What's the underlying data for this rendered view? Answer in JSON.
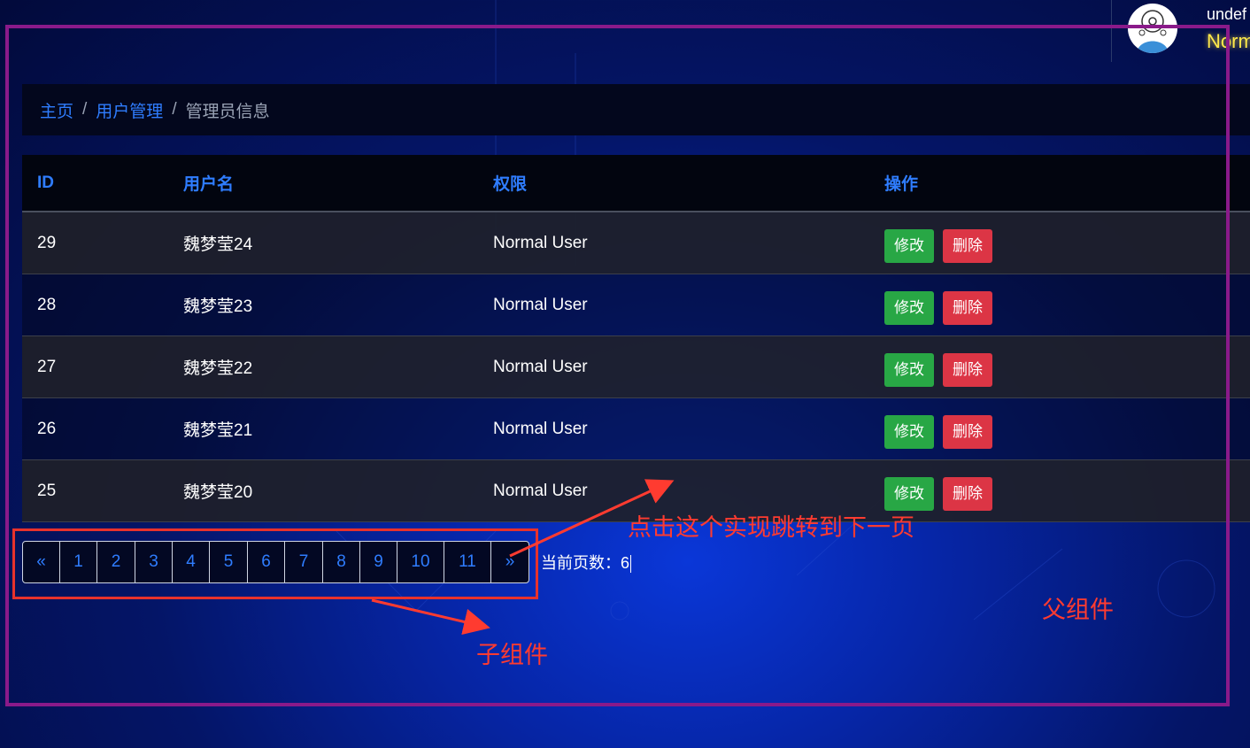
{
  "user": {
    "name": "undef",
    "role": "Norm"
  },
  "breadcrumb": {
    "home": "主页",
    "section": "用户管理",
    "current": "管理员信息",
    "separator": "/"
  },
  "table": {
    "headers": [
      "ID",
      "用户名",
      "权限",
      "操作"
    ],
    "rows": [
      {
        "id": "29",
        "name": "魏梦莹24",
        "permission": "Normal User",
        "edit": "修改",
        "delete": "删除"
      },
      {
        "id": "28",
        "name": "魏梦莹23",
        "permission": "Normal User",
        "edit": "修改",
        "delete": "删除"
      },
      {
        "id": "27",
        "name": "魏梦莹22",
        "permission": "Normal User",
        "edit": "修改",
        "delete": "删除"
      },
      {
        "id": "26",
        "name": "魏梦莹21",
        "permission": "Normal User",
        "edit": "修改",
        "delete": "删除"
      },
      {
        "id": "25",
        "name": "魏梦莹20",
        "permission": "Normal User",
        "edit": "修改",
        "delete": "删除"
      }
    ]
  },
  "pagination": {
    "prev": "«",
    "pages": [
      "1",
      "2",
      "3",
      "4",
      "5",
      "6",
      "7",
      "8",
      "9",
      "10",
      "11"
    ],
    "next": "»",
    "current_label": "当前页数：",
    "current_value": "6"
  },
  "annotations": {
    "next_hint": "点击这个实现跳转到下一页",
    "child_component": "子组件",
    "parent_component": "父组件"
  },
  "colors": {
    "link": "#2f7dff",
    "edit_button": "#28a745",
    "delete_button": "#dc3545",
    "annotation_red": "#ff3b30",
    "annotation_purple": "#8a1a8a",
    "role_yellow": "#ffe94a"
  }
}
